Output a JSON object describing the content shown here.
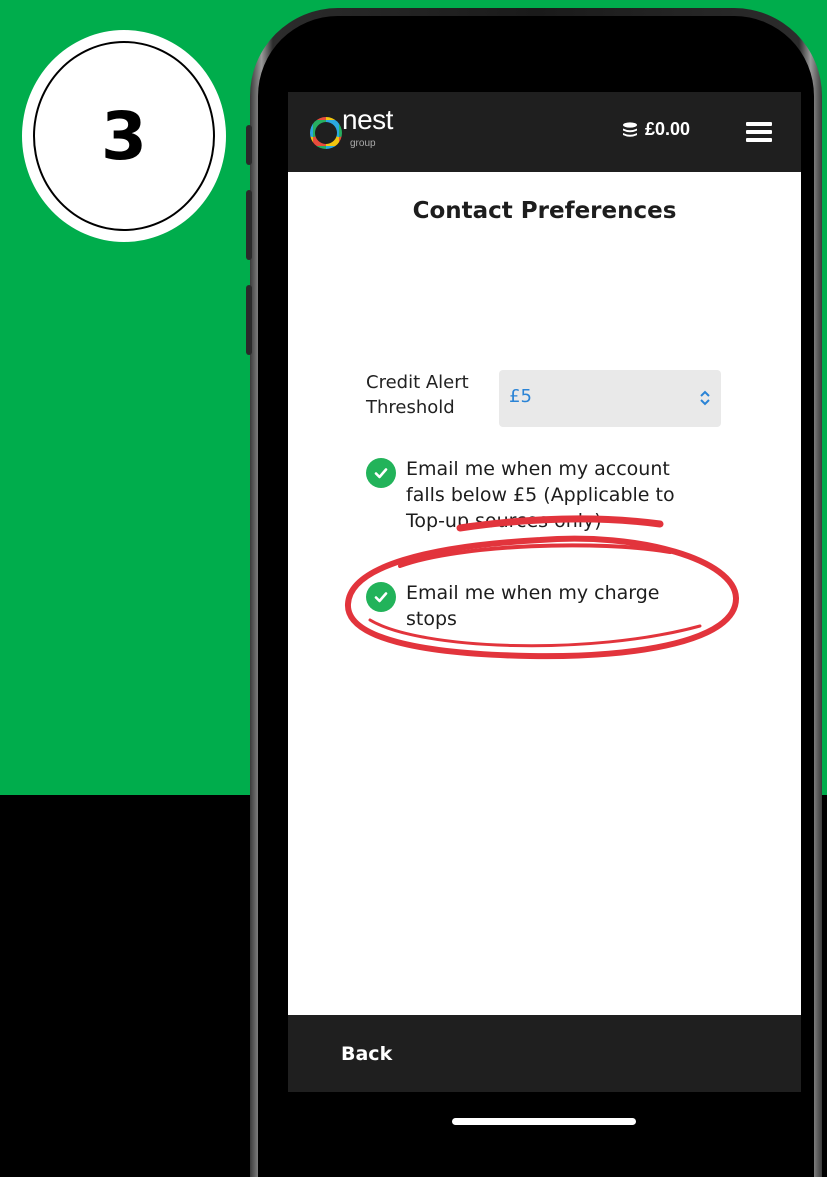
{
  "step": {
    "number": "3"
  },
  "app": {
    "logo_text": "nest",
    "logo_sub": "group",
    "balance": "£0.00"
  },
  "page": {
    "title": "Contact Preferences"
  },
  "threshold": {
    "label": "Credit Alert Threshold",
    "selected": "£5"
  },
  "preferences": [
    {
      "text": "Email me when my account falls below £5 (Applicable to Top-up sources only)",
      "checked": true
    },
    {
      "text": "Email me when my charge stops",
      "checked": true,
      "highlighted": true
    }
  ],
  "footer": {
    "back_label": "Back"
  },
  "colors": {
    "accent_green": "#00ad4c",
    "check_green": "#22b35a",
    "header_dark": "#1f1f1f",
    "select_text": "#2b84d6",
    "annotation_red": "#e2343c"
  }
}
